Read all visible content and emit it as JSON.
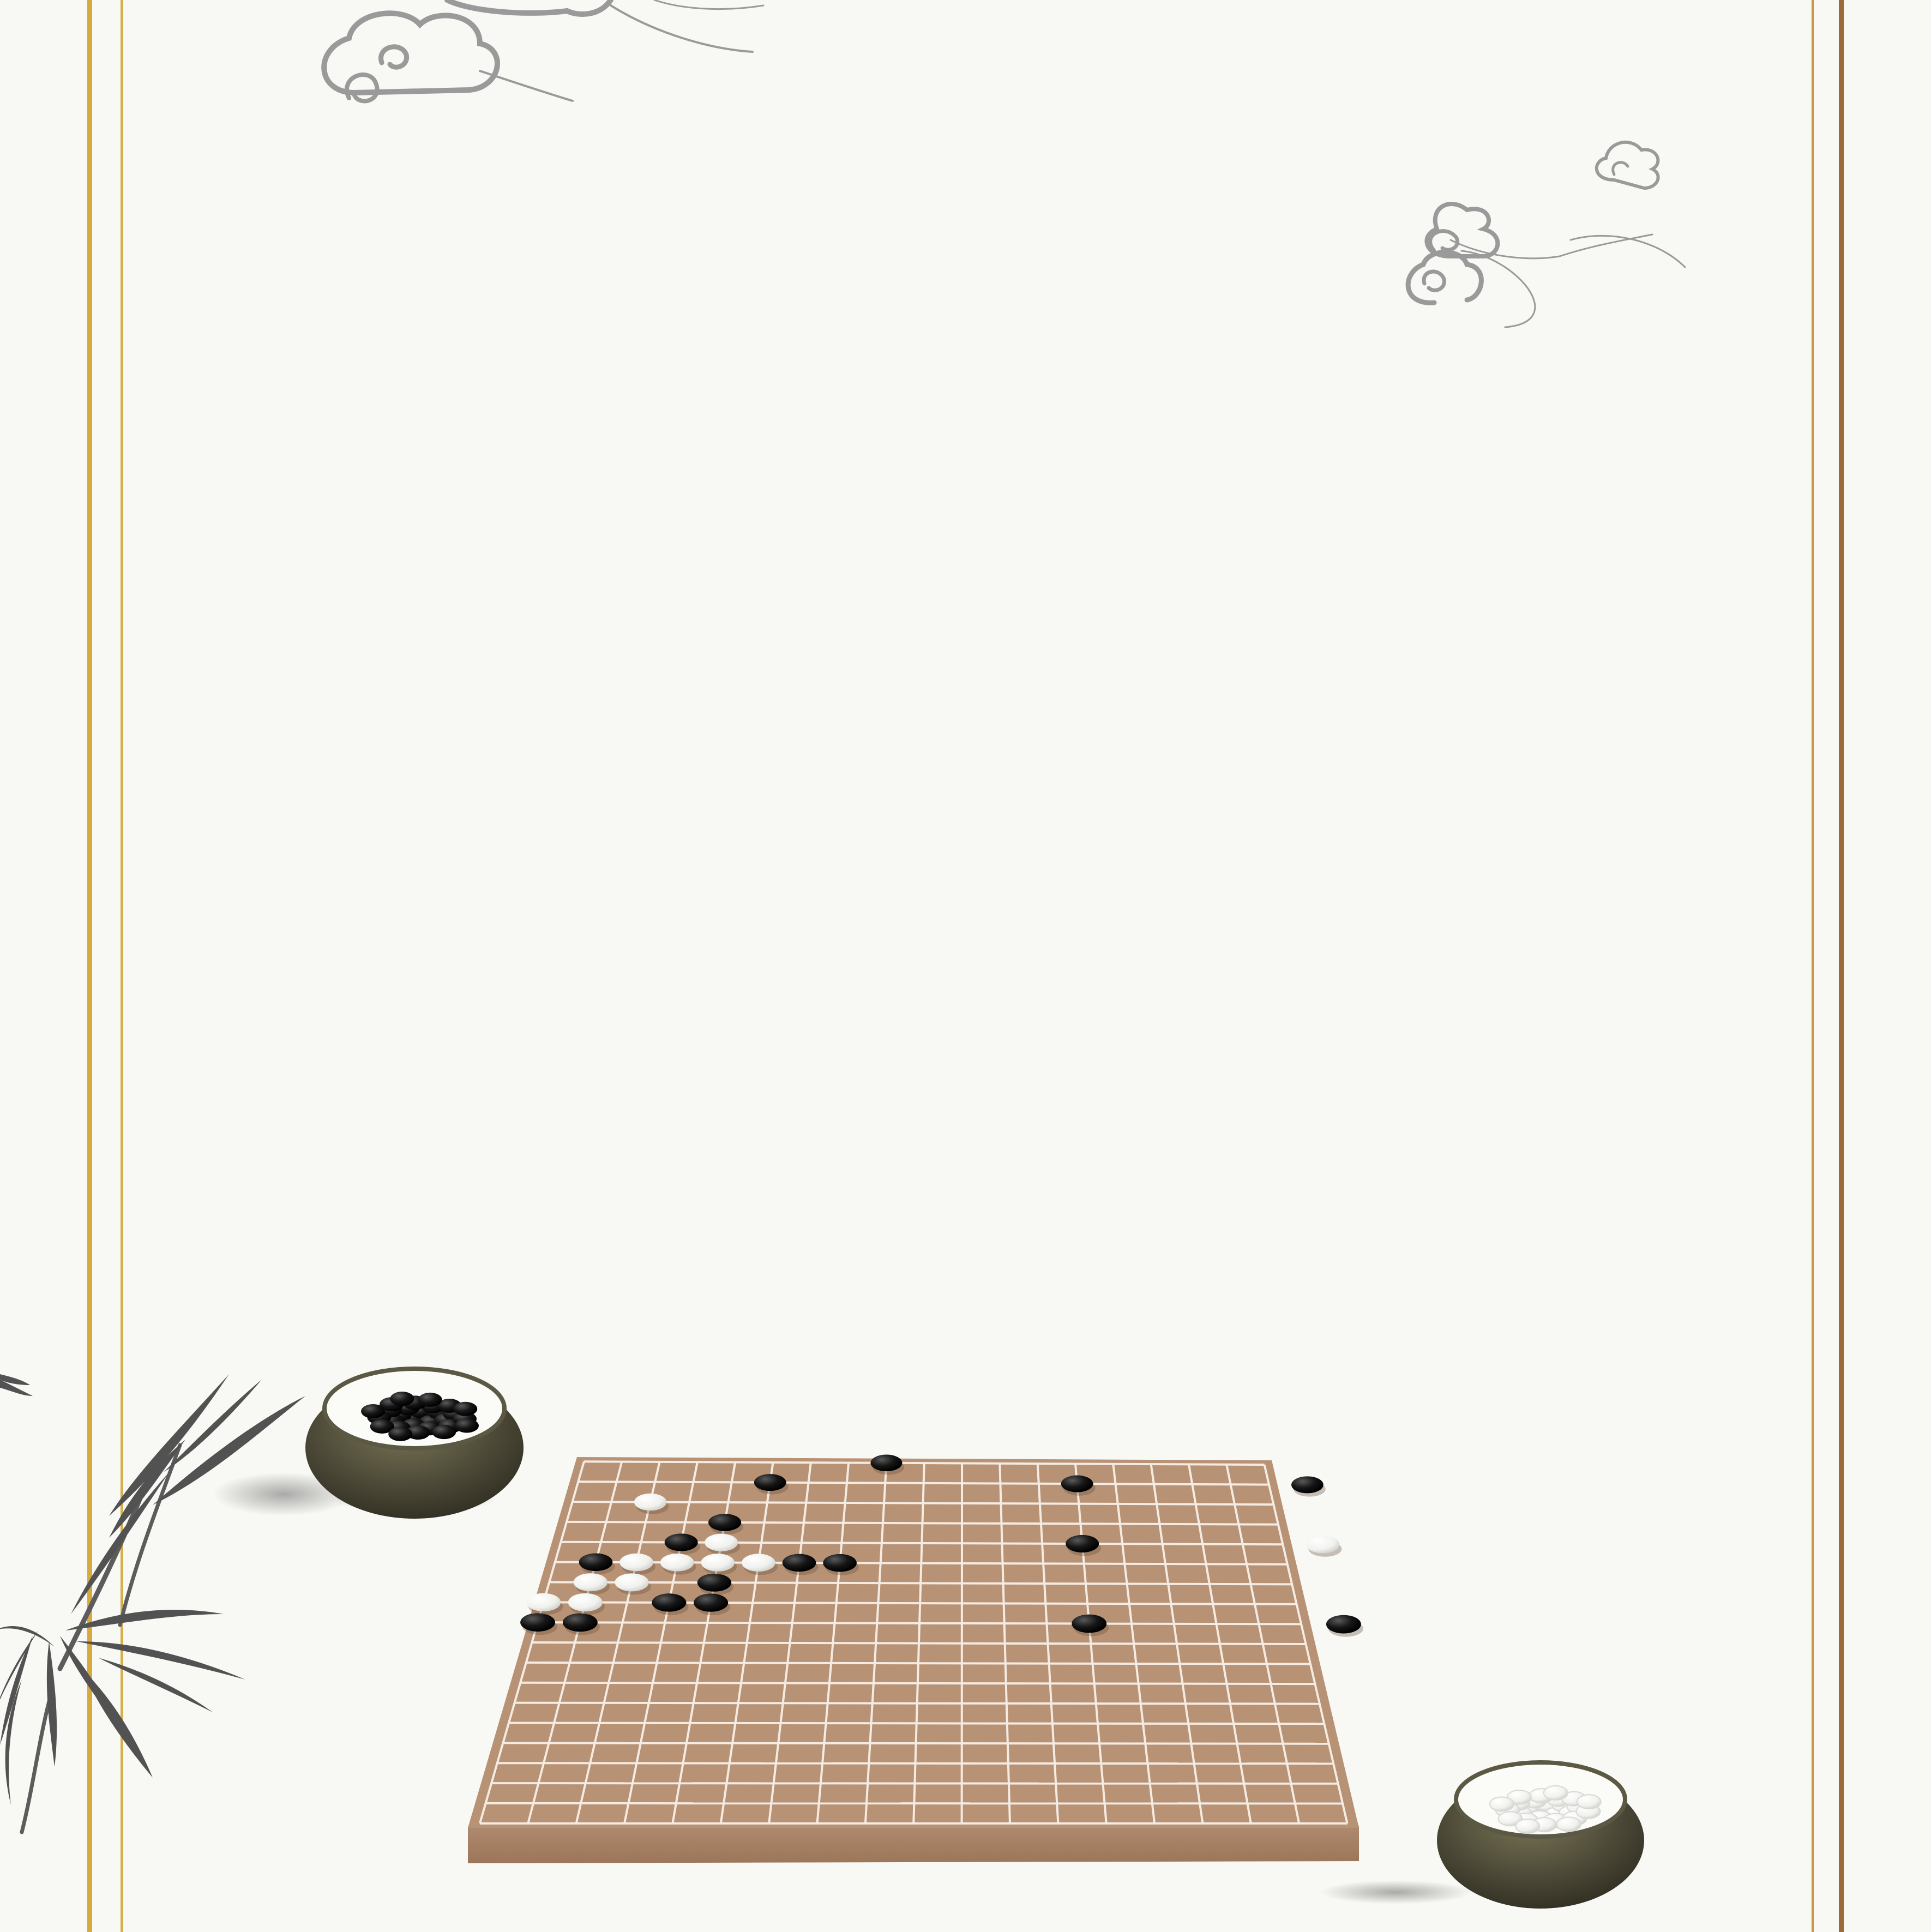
{
  "colors": {
    "background": "#f8f8f4",
    "frame_gold": "#d6a941",
    "frame_bronze": "#9a6a38",
    "board_face": "#b89274",
    "board_edge": "#a88064",
    "grid_line": "#f4ebe3",
    "stone_black": "#161616",
    "stone_white": "#f4f4f2",
    "bowl": "#4d4a38",
    "ink_wash": "#5a5a5a",
    "cloud_ink": "#9a9a9a"
  },
  "board": {
    "lines": 19,
    "black_stones": [
      [
        5,
        1
      ],
      [
        8,
        0
      ],
      [
        13,
        1
      ],
      [
        19,
        1
      ],
      [
        4,
        3
      ],
      [
        3,
        4
      ],
      [
        13,
        4
      ],
      [
        1,
        5
      ],
      [
        6,
        5
      ],
      [
        7,
        5
      ],
      [
        4,
        6
      ],
      [
        3,
        7
      ],
      [
        4,
        7
      ],
      [
        0,
        8
      ],
      [
        1,
        8
      ],
      [
        13,
        8
      ],
      [
        19,
        8
      ]
    ],
    "white_stones": [
      [
        2,
        2
      ],
      [
        19,
        4
      ],
      [
        4,
        4
      ],
      [
        5,
        5
      ],
      [
        2,
        5
      ],
      [
        3,
        5
      ],
      [
        4,
        5
      ],
      [
        1,
        6
      ],
      [
        2,
        6
      ],
      [
        1,
        7
      ],
      [
        0,
        7
      ]
    ]
  },
  "bowls": [
    {
      "name": "black-stone-bowl",
      "contents": "black"
    },
    {
      "name": "white-stone-bowl",
      "contents": "white"
    }
  ],
  "decorations": {
    "clouds": [
      "cloud-top-left",
      "cloud-top-right"
    ],
    "plant": "bamboo",
    "frame": "double-gold-border"
  }
}
